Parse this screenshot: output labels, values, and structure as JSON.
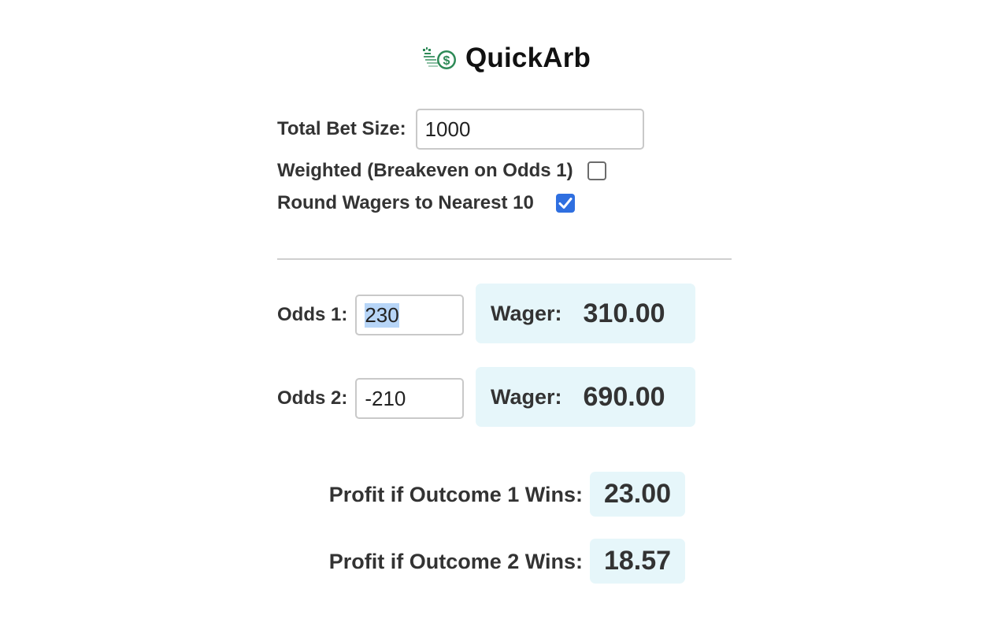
{
  "app": {
    "title": "QuickArb",
    "logo_icon": "money-coin-icon",
    "accent_color": "#2f6fe0",
    "result_box_color": "#e6f6fa",
    "logo_color": "#2e8a57"
  },
  "settings": {
    "total_bet_label": "Total Bet Size:",
    "total_bet_value": "1000",
    "weighted_label": "Weighted (Breakeven on Odds 1)",
    "weighted_checked": false,
    "round_label": "Round Wagers to Nearest 10",
    "round_checked": true
  },
  "odds": [
    {
      "label": "Odds 1:",
      "value": "230",
      "wager_label": "Wager:",
      "wager_value": "310.00"
    },
    {
      "label": "Odds 2:",
      "value": "-210",
      "wager_label": "Wager:",
      "wager_value": "690.00"
    }
  ],
  "profits": [
    {
      "label": "Profit if Outcome 1 Wins:",
      "value": "23.00"
    },
    {
      "label": "Profit if Outcome 2 Wins:",
      "value": "18.57"
    }
  ]
}
